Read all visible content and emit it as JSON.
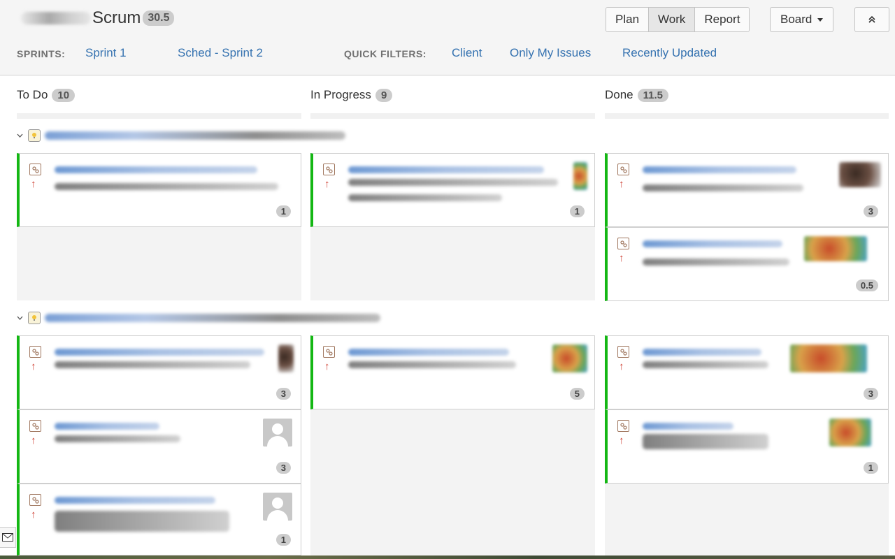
{
  "header": {
    "title": "Scrum",
    "points": "30.5",
    "views": [
      "Plan",
      "Work",
      "Report"
    ],
    "active_view": "Work",
    "board_label": "Board"
  },
  "filters": {
    "sprints_label": "SPRINTS:",
    "sprints": [
      "Sprint 1",
      "Sched - Sprint 2"
    ],
    "quick_label": "QUICK FILTERS:",
    "quick": [
      "Client",
      "Only My Issues",
      "Recently Updated"
    ]
  },
  "columns": [
    {
      "name": "To Do",
      "count": "10"
    },
    {
      "name": "In Progress",
      "count": "9"
    },
    {
      "name": "Done",
      "count": "11.5"
    }
  ],
  "cards": [
    {
      "lane": 1,
      "column": "To Do",
      "estimate": "1",
      "priority_icon": "arrow-up-icon"
    },
    {
      "lane": 1,
      "column": "In Progress",
      "estimate": "1",
      "priority_icon": "arrow-up-icon"
    },
    {
      "lane": 1,
      "column": "Done",
      "estimate": "3",
      "priority_icon": "arrow-up-icon"
    },
    {
      "lane": 1,
      "column": "Done",
      "estimate": "0.5",
      "priority_icon": "arrow-up-icon"
    },
    {
      "lane": 2,
      "column": "To Do",
      "estimate": "3",
      "priority_icon": "arrow-up-icon"
    },
    {
      "lane": 2,
      "column": "To Do",
      "estimate": "3",
      "priority_icon": "arrow-up-icon"
    },
    {
      "lane": 2,
      "column": "To Do",
      "estimate": "1",
      "priority_icon": "arrow-up-icon"
    },
    {
      "lane": 2,
      "column": "In Progress",
      "estimate": "5",
      "priority_icon": "arrow-up-icon"
    },
    {
      "lane": 2,
      "column": "Done",
      "estimate": "3",
      "priority_icon": "arrow-up-icon"
    },
    {
      "lane": 2,
      "column": "Done",
      "estimate": "1",
      "priority_icon": "arrow-up-icon"
    }
  ],
  "colors": {
    "link": "#3572b0",
    "card_accent": "#14b714",
    "priority": "#d04437"
  }
}
